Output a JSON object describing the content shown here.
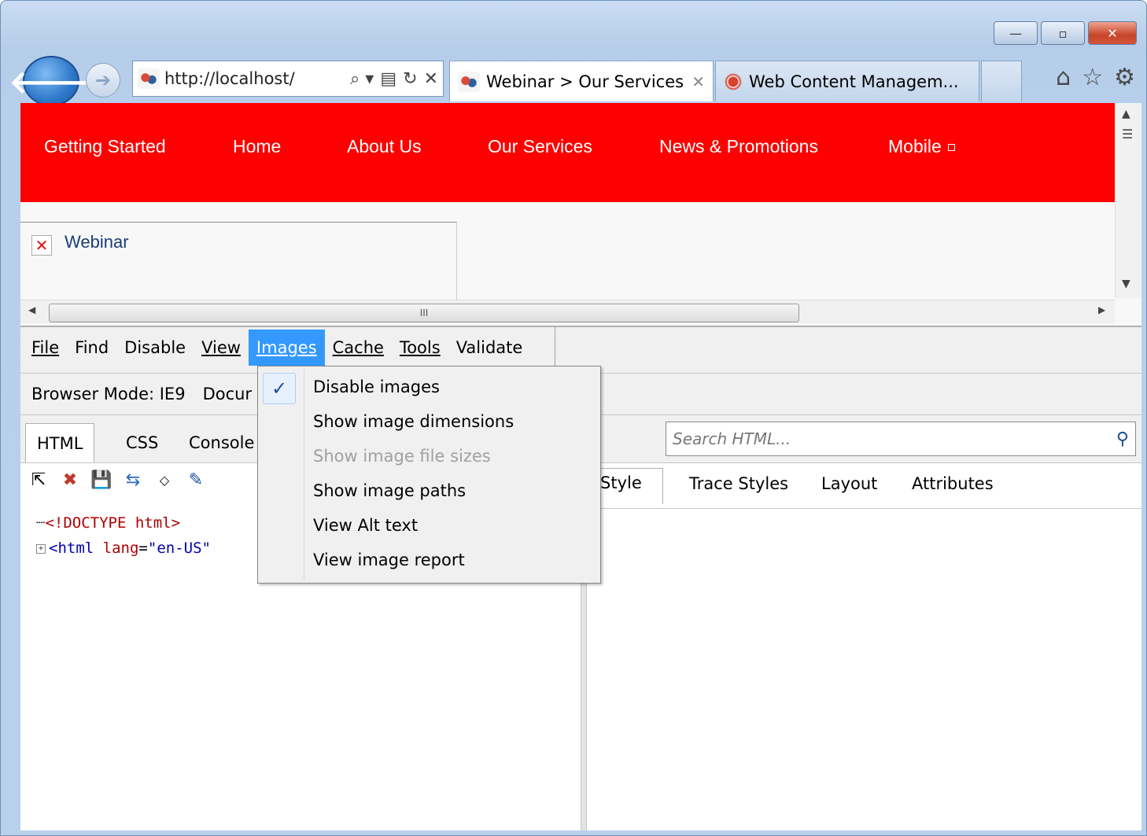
{
  "window": {
    "minimize": "—",
    "restore": "▫",
    "close": "✕"
  },
  "nav": {
    "back_icon": "arrow-left-icon",
    "forward_icon": "arrow-right-icon",
    "address": "http://localhost/",
    "address_tools": [
      "⌕ ▾",
      "▤",
      "↻",
      "✕"
    ]
  },
  "tabs": [
    {
      "label": "Webinar > Our Services",
      "close": "✕"
    },
    {
      "label": "Web Content Managem..."
    }
  ],
  "toolbar_icons": [
    "home-icon",
    "favorites-star-icon",
    "settings-gear-icon"
  ],
  "site": {
    "nav_links": [
      "Getting Started",
      "Home",
      "About Us",
      "Our Services",
      "News & Promotions",
      "Mobile"
    ],
    "webinar_link": "Webinar",
    "hscroll_grip": "III"
  },
  "devtools": {
    "menu": [
      "File",
      "Find",
      "Disable",
      "View",
      "Images",
      "Cache",
      "Tools",
      "Validate"
    ],
    "browser_mode": "Browser Mode: IE9",
    "document_mode": "Docur",
    "tabs": [
      "HTML",
      "CSS",
      "Console"
    ],
    "search_placeholder": "Search HTML...",
    "tree": {
      "doctype": "<!DOCTYPE html>",
      "html_tag": "<html",
      "html_attr": "lang",
      "html_eq": "=",
      "html_val": "\"en-US\""
    },
    "right_tabs": [
      "Style",
      "Trace Styles",
      "Layout",
      "Attributes"
    ]
  },
  "images_menu": {
    "check": "✓",
    "items": [
      {
        "label": "Disable images",
        "checked": true,
        "enabled": true
      },
      {
        "label": "Show image dimensions",
        "enabled": true
      },
      {
        "label": "Show image file sizes",
        "enabled": false
      },
      {
        "label": "Show image paths",
        "enabled": true
      },
      {
        "label": "View Alt text",
        "enabled": true
      },
      {
        "label": "View image report",
        "enabled": true
      }
    ]
  },
  "colors": {
    "site_nav_bg": "#ff0000",
    "menu_highlight": "#3399ff"
  }
}
